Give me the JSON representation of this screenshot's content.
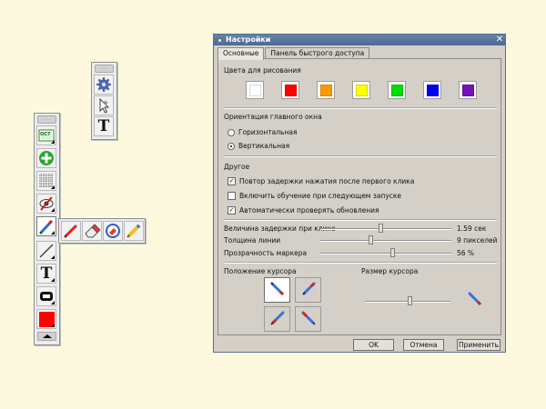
{
  "toolbar_small": {
    "grip": "...",
    "items": [
      {
        "name": "settings",
        "icon": "gear-icon"
      },
      {
        "name": "pointer",
        "icon": "cursor-arrow-icon"
      },
      {
        "name": "text",
        "icon": "text-icon",
        "glyph": "T"
      }
    ]
  },
  "toolbar_main": {
    "grip": "....",
    "items": [
      {
        "name": "screenshot",
        "icon": "camera-screenshot-icon",
        "label": "OC7"
      },
      {
        "name": "add",
        "icon": "green-plus-icon"
      },
      {
        "name": "grid",
        "icon": "grid-icon"
      },
      {
        "name": "hide",
        "icon": "eye-off-icon"
      },
      {
        "name": "marker",
        "icon": "marker-icon"
      },
      {
        "name": "line",
        "icon": "line-icon"
      },
      {
        "name": "text",
        "icon": "text-icon",
        "glyph": "T"
      },
      {
        "name": "shape",
        "icon": "shape-icon"
      },
      {
        "name": "color",
        "icon": "color-swatch-icon",
        "color": "#ff0000"
      },
      {
        "name": "collapse",
        "icon": "collapse-arrow-icon"
      }
    ],
    "flyout": [
      {
        "name": "pen",
        "icon": "pen-icon"
      },
      {
        "name": "eraser",
        "icon": "eraser-icon"
      },
      {
        "name": "clear",
        "icon": "eraser-clear-icon"
      },
      {
        "name": "pencil",
        "icon": "pencil-icon"
      }
    ]
  },
  "dialog": {
    "title": "Настройки",
    "close": "✕",
    "tabs": [
      "Основные",
      "Панель быстрого доступа"
    ],
    "colors_title": "Цвета для рисования",
    "colors": [
      "#ffffff",
      "#ff0000",
      "#ff9900",
      "#ffff00",
      "#00dd00",
      "#0000ee",
      "#7711bb"
    ],
    "orientation_title": "Ориентация главного окна",
    "orientation_options": [
      "Горизонтальная",
      "Вертикальная"
    ],
    "orientation_selected": 1,
    "other_title": "Другое",
    "checkboxes": [
      {
        "label": "Повтор задержки нажатия после первого клика",
        "checked": true
      },
      {
        "label": "Включить обучение при следующем запуске",
        "checked": false
      },
      {
        "label": "Автоматически проверять обновления",
        "checked": true
      }
    ],
    "sliders": [
      {
        "label": "Величина задержки при клике",
        "value": "1.59 сек",
        "fraction": 0.46
      },
      {
        "label": "Толщина линии",
        "value": "9 пикселей",
        "fraction": 0.38
      },
      {
        "label": "Прозрачность маркера",
        "value": "56 %",
        "fraction": 0.55
      }
    ],
    "cursor_position_title": "Положение курсора",
    "cursor_size_title": "Размер курсора",
    "cursor_size_fraction": 0.52,
    "buttons": {
      "ok": "OK",
      "cancel": "Отмена",
      "apply": "Применить"
    }
  }
}
